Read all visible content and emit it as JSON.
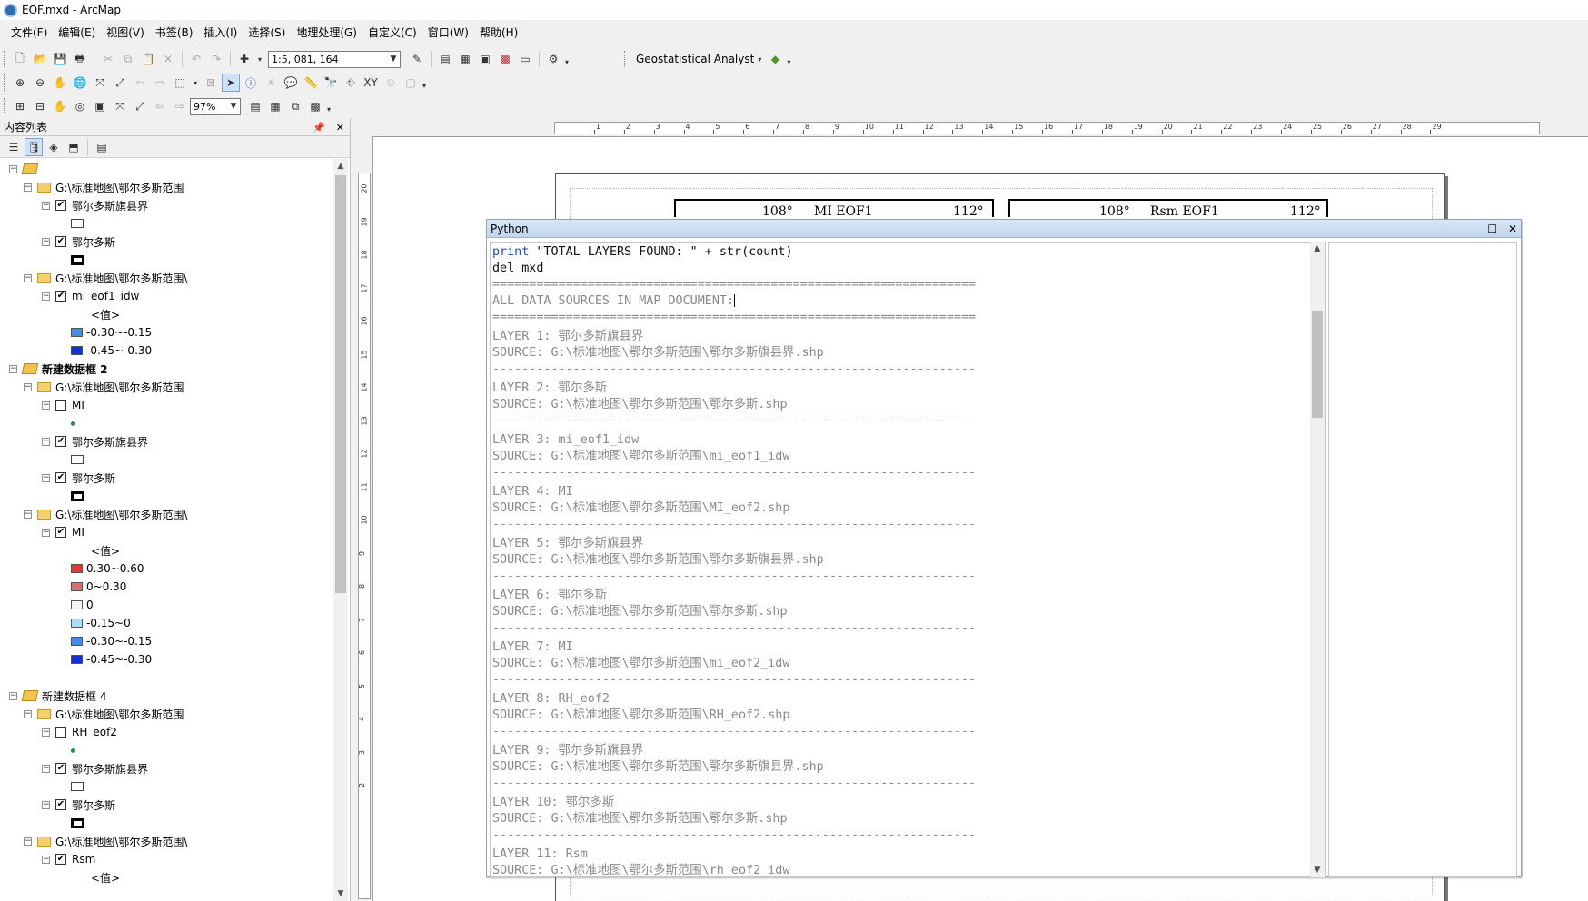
{
  "window": {
    "title": "EOF.mxd - ArcMap"
  },
  "menu": [
    "文件(F)",
    "编辑(E)",
    "视图(V)",
    "书签(B)",
    "插入(I)",
    "选择(S)",
    "地理处理(G)",
    "自定义(C)",
    "窗口(W)",
    "帮助(H)"
  ],
  "toolbar": {
    "scale": "1:5, 081, 164",
    "geostat_label": "Geostatistical Analyst",
    "zoom": "97%"
  },
  "toc": {
    "title": "内容列表",
    "rows": [
      {
        "label": "",
        "type": "frame",
        "expander": "−"
      },
      {
        "label": "G:\\标准地图\\鄂尔多斯范围",
        "type": "folder",
        "expander": "−"
      },
      {
        "label": "鄂尔多斯旗县界",
        "type": "layer",
        "checked": true,
        "expander": "−"
      },
      {
        "label": "",
        "type": "sym-rect"
      },
      {
        "label": "鄂尔多斯",
        "type": "layer",
        "checked": true,
        "expander": "−"
      },
      {
        "label": "",
        "type": "sym-rect-bold"
      },
      {
        "label": "G:\\标准地图\\鄂尔多斯范围\\",
        "type": "folder",
        "expander": "−"
      },
      {
        "label": "mi_eof1_idw",
        "type": "layer",
        "checked": true,
        "expander": "−"
      },
      {
        "label": "<值>",
        "type": "value-header"
      },
      {
        "label": "-0.30~-0.15",
        "type": "class",
        "color": "#3d8ee8"
      },
      {
        "label": "-0.45~-0.30",
        "type": "class",
        "color": "#1032d8"
      },
      {
        "label": "新建数据框 2",
        "type": "frame",
        "expander": "−",
        "bold": true
      },
      {
        "label": "G:\\标准地图\\鄂尔多斯范围",
        "type": "folder",
        "expander": "−"
      },
      {
        "label": "MI",
        "type": "layer",
        "checked": false,
        "expander": "−"
      },
      {
        "label": "",
        "type": "sym-dot"
      },
      {
        "label": "鄂尔多斯旗县界",
        "type": "layer",
        "checked": true,
        "expander": "−"
      },
      {
        "label": "",
        "type": "sym-rect"
      },
      {
        "label": "鄂尔多斯",
        "type": "layer",
        "checked": true,
        "expander": "−"
      },
      {
        "label": "",
        "type": "sym-rect-bold"
      },
      {
        "label": "G:\\标准地图\\鄂尔多斯范围\\",
        "type": "folder",
        "expander": "−"
      },
      {
        "label": "MI",
        "type": "layer",
        "checked": true,
        "expander": "−"
      },
      {
        "label": "<值>",
        "type": "value-header"
      },
      {
        "label": "0.30~0.60",
        "type": "class",
        "color": "#e83434"
      },
      {
        "label": "0~0.30",
        "type": "class",
        "color": "#d97070"
      },
      {
        "label": "0",
        "type": "class",
        "color": "#f4f4f4"
      },
      {
        "label": "-0.15~0",
        "type": "class",
        "color": "#a6e2f6"
      },
      {
        "label": "-0.30~-0.15",
        "type": "class",
        "color": "#3d8ee8"
      },
      {
        "label": "-0.45~-0.30",
        "type": "class",
        "color": "#1032d8"
      },
      {
        "label": "",
        "type": "blank"
      },
      {
        "label": "新建数据框 4",
        "type": "frame",
        "expander": "−"
      },
      {
        "label": "G:\\标准地图\\鄂尔多斯范围",
        "type": "folder",
        "expander": "−"
      },
      {
        "label": "RH_eof2",
        "type": "layer",
        "checked": false,
        "expander": "−"
      },
      {
        "label": "",
        "type": "sym-dot"
      },
      {
        "label": "鄂尔多斯旗县界",
        "type": "layer",
        "checked": true,
        "expander": "−"
      },
      {
        "label": "",
        "type": "sym-rect"
      },
      {
        "label": "鄂尔多斯",
        "type": "layer",
        "checked": true,
        "expander": "−"
      },
      {
        "label": "",
        "type": "sym-rect-bold"
      },
      {
        "label": "G:\\标准地图\\鄂尔多斯范围\\",
        "type": "folder",
        "expander": "−"
      },
      {
        "label": "Rsm",
        "type": "layer",
        "checked": true,
        "expander": "−"
      },
      {
        "label": "<值>",
        "type": "value-header"
      }
    ]
  },
  "layout": {
    "ruler_top": [
      "1",
      "2",
      "3",
      "4",
      "5",
      "6",
      "7",
      "8",
      "9",
      "10",
      "11",
      "12",
      "13",
      "14",
      "15",
      "16",
      "17",
      "18",
      "19",
      "20",
      "21",
      "22",
      "23",
      "24",
      "25",
      "26",
      "27",
      "28",
      "29"
    ],
    "ruler_left": [
      "20",
      "19",
      "18",
      "17",
      "16",
      "15",
      "14",
      "13",
      "12",
      "11",
      "10",
      "9",
      "8",
      "7",
      "6",
      "5",
      "4",
      "3",
      "2"
    ],
    "map1": {
      "lon_left": "108°",
      "title": "MI EOF1",
      "lon_right": "112°"
    },
    "map2": {
      "lon_left": "108°",
      "title": "Rsm EOF1",
      "lon_right": "112°"
    }
  },
  "python": {
    "title": "Python",
    "lines": [
      {
        "segments": [
          {
            "t": "print",
            "c": "kw"
          },
          {
            "t": " \"TOTAL LAYERS FOUND: \" + str(count)",
            "c": "blk"
          }
        ]
      },
      {
        "segments": [
          {
            "t": "del mxd",
            "c": "blk"
          }
        ]
      },
      {
        "segments": [
          {
            "t": "==================================================================",
            "c": "grey"
          }
        ]
      },
      {
        "segments": [
          {
            "t": "ALL DATA SOURCES IN MAP DOCUMENT:",
            "c": "grey"
          }
        ],
        "caret": true
      },
      {
        "segments": [
          {
            "t": "==================================================================",
            "c": "grey"
          }
        ]
      },
      {
        "segments": [
          {
            "t": "LAYER 1: 鄂尔多斯旗县界",
            "c": "grey"
          }
        ]
      },
      {
        "segments": [
          {
            "t": "SOURCE: G:\\标准地图\\鄂尔多斯范围\\鄂尔多斯旗县界.shp",
            "c": "grey"
          }
        ]
      },
      {
        "segments": [
          {
            "t": "------------------------------------------------------------------",
            "c": "grey"
          }
        ]
      },
      {
        "segments": [
          {
            "t": "LAYER 2: 鄂尔多斯",
            "c": "grey"
          }
        ]
      },
      {
        "segments": [
          {
            "t": "SOURCE: G:\\标准地图\\鄂尔多斯范围\\鄂尔多斯.shp",
            "c": "grey"
          }
        ]
      },
      {
        "segments": [
          {
            "t": "------------------------------------------------------------------",
            "c": "grey"
          }
        ]
      },
      {
        "segments": [
          {
            "t": "LAYER 3: mi_eof1_idw",
            "c": "grey"
          }
        ]
      },
      {
        "segments": [
          {
            "t": "SOURCE: G:\\标准地图\\鄂尔多斯范围\\mi_eof1_idw",
            "c": "grey"
          }
        ]
      },
      {
        "segments": [
          {
            "t": "------------------------------------------------------------------",
            "c": "grey"
          }
        ]
      },
      {
        "segments": [
          {
            "t": "LAYER 4: MI",
            "c": "grey"
          }
        ]
      },
      {
        "segments": [
          {
            "t": "SOURCE: G:\\标准地图\\鄂尔多斯范围\\MI_eof2.shp",
            "c": "grey"
          }
        ]
      },
      {
        "segments": [
          {
            "t": "------------------------------------------------------------------",
            "c": "grey"
          }
        ]
      },
      {
        "segments": [
          {
            "t": "LAYER 5: 鄂尔多斯旗县界",
            "c": "grey"
          }
        ]
      },
      {
        "segments": [
          {
            "t": "SOURCE: G:\\标准地图\\鄂尔多斯范围\\鄂尔多斯旗县界.shp",
            "c": "grey"
          }
        ]
      },
      {
        "segments": [
          {
            "t": "------------------------------------------------------------------",
            "c": "grey"
          }
        ]
      },
      {
        "segments": [
          {
            "t": "LAYER 6: 鄂尔多斯",
            "c": "grey"
          }
        ]
      },
      {
        "segments": [
          {
            "t": "SOURCE: G:\\标准地图\\鄂尔多斯范围\\鄂尔多斯.shp",
            "c": "grey"
          }
        ]
      },
      {
        "segments": [
          {
            "t": "------------------------------------------------------------------",
            "c": "grey"
          }
        ]
      },
      {
        "segments": [
          {
            "t": "LAYER 7: MI",
            "c": "grey"
          }
        ]
      },
      {
        "segments": [
          {
            "t": "SOURCE: G:\\标准地图\\鄂尔多斯范围\\mi_eof2_idw",
            "c": "grey"
          }
        ]
      },
      {
        "segments": [
          {
            "t": "------------------------------------------------------------------",
            "c": "grey"
          }
        ]
      },
      {
        "segments": [
          {
            "t": "LAYER 8: RH_eof2",
            "c": "grey"
          }
        ]
      },
      {
        "segments": [
          {
            "t": "SOURCE: G:\\标准地图\\鄂尔多斯范围\\RH_eof2.shp",
            "c": "grey"
          }
        ]
      },
      {
        "segments": [
          {
            "t": "------------------------------------------------------------------",
            "c": "grey"
          }
        ]
      },
      {
        "segments": [
          {
            "t": "LAYER 9: 鄂尔多斯旗县界",
            "c": "grey"
          }
        ]
      },
      {
        "segments": [
          {
            "t": "SOURCE: G:\\标准地图\\鄂尔多斯范围\\鄂尔多斯旗县界.shp",
            "c": "grey"
          }
        ]
      },
      {
        "segments": [
          {
            "t": "------------------------------------------------------------------",
            "c": "grey"
          }
        ]
      },
      {
        "segments": [
          {
            "t": "LAYER 10: 鄂尔多斯",
            "c": "grey"
          }
        ]
      },
      {
        "segments": [
          {
            "t": "SOURCE: G:\\标准地图\\鄂尔多斯范围\\鄂尔多斯.shp",
            "c": "grey"
          }
        ]
      },
      {
        "segments": [
          {
            "t": "------------------------------------------------------------------",
            "c": "grey"
          }
        ]
      },
      {
        "segments": [
          {
            "t": "LAYER 11: Rsm",
            "c": "grey"
          }
        ]
      },
      {
        "segments": [
          {
            "t": "SOURCE: G:\\标准地图\\鄂尔多斯范围\\rh_eof2_idw",
            "c": "grey"
          }
        ]
      }
    ]
  }
}
